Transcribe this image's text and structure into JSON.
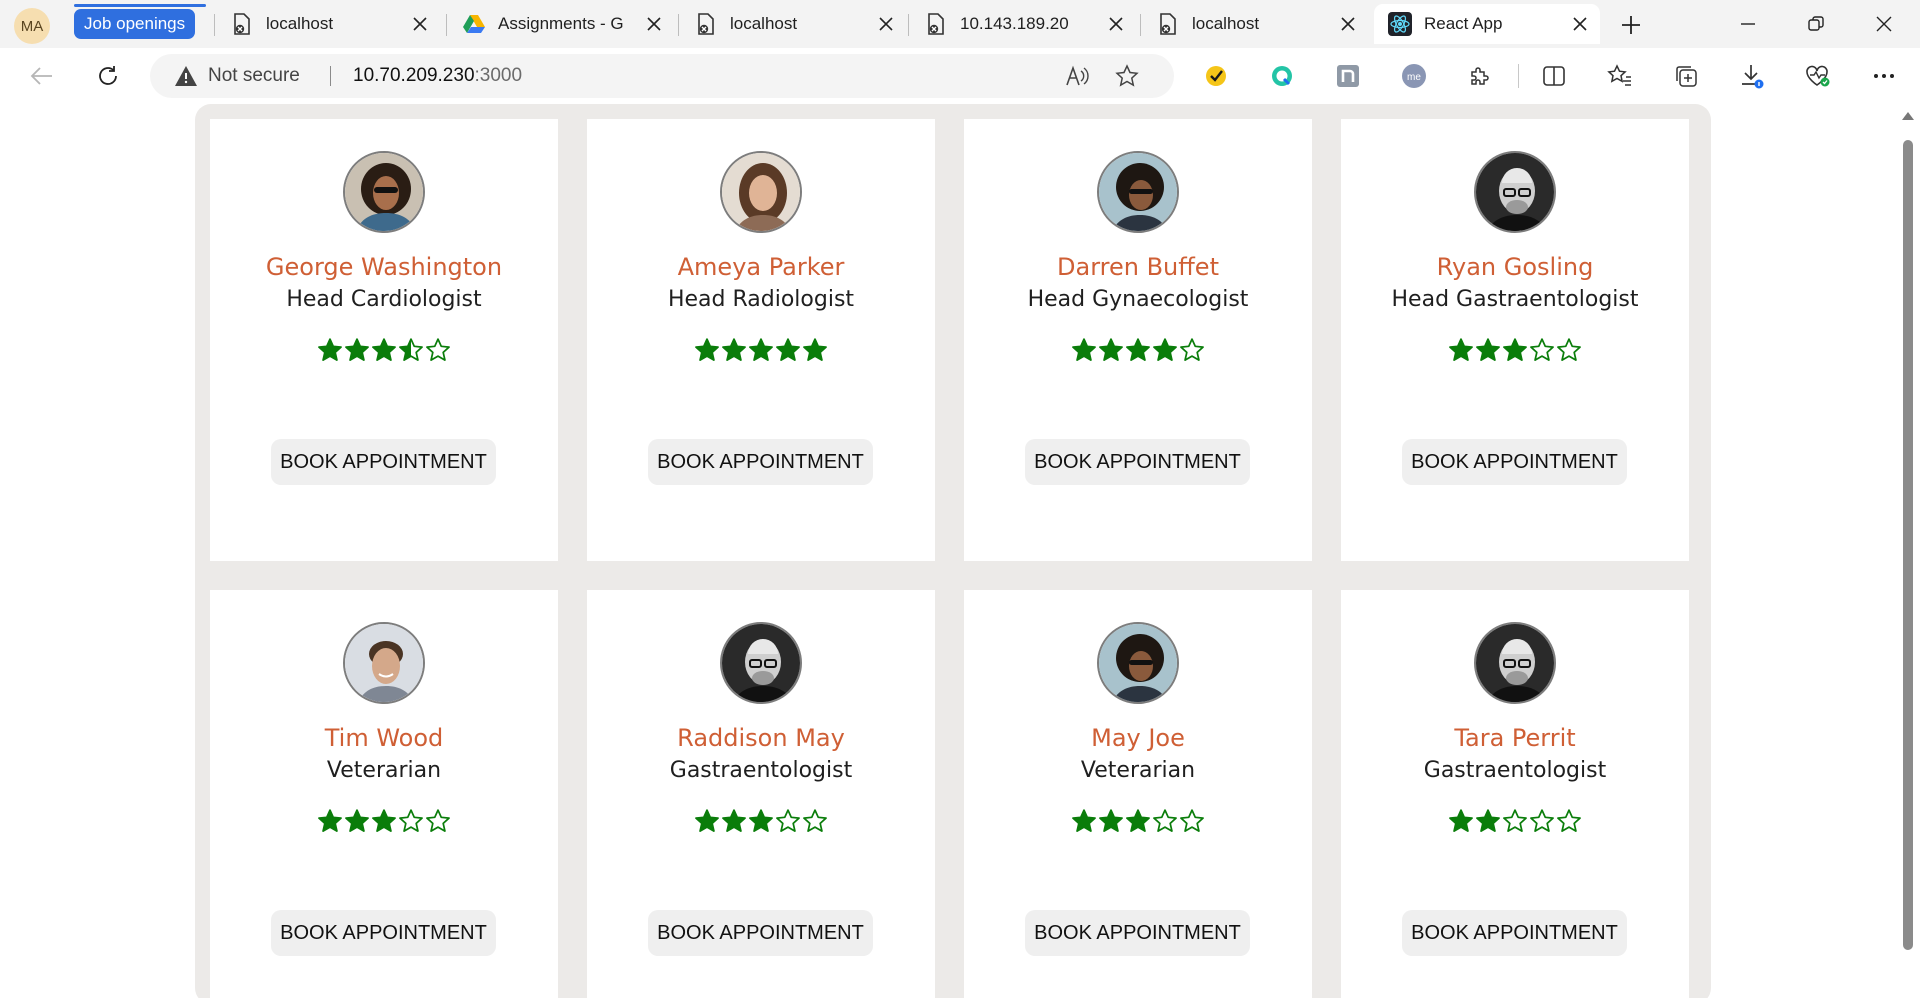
{
  "browser": {
    "profile_initials": "MA",
    "tab_group_label": "Job openings",
    "tabs": [
      {
        "title": "localhost",
        "icon": "blocked-page-icon"
      },
      {
        "title": "Assignments - G",
        "icon": "google-drive-icon"
      },
      {
        "title": "localhost",
        "icon": "blocked-page-icon"
      },
      {
        "title": "10.143.189.20",
        "icon": "blocked-page-icon"
      },
      {
        "title": "localhost",
        "icon": "blocked-page-icon"
      },
      {
        "title": "React App",
        "icon": "react-icon",
        "active": true
      }
    ],
    "address": {
      "security_label": "Not secure",
      "host": "10.70.209.230",
      "port": ":3000"
    }
  },
  "doctors": [
    {
      "name": "George Washington",
      "role": "Head Cardiologist",
      "rating": 3.5,
      "button": "Book Appointment"
    },
    {
      "name": "Ameya Parker",
      "role": "Head Radiologist",
      "rating": 5,
      "button": "Book Appointment"
    },
    {
      "name": "Darren Buffet",
      "role": "Head Gynaecologist",
      "rating": 4,
      "button": "Book Appointment"
    },
    {
      "name": "Ryan Gosling",
      "role": "Head Gastraentologist",
      "rating": 3,
      "button": "Book Appointment"
    },
    {
      "name": "Tim Wood",
      "role": "Veterarian",
      "rating": 3,
      "button": "Book Appointment"
    },
    {
      "name": "Raddison May",
      "role": "Gastraentologist",
      "rating": 3,
      "button": "Book Appointment"
    },
    {
      "name": "May Joe",
      "role": "Veterarian",
      "rating": 3,
      "button": "Book Appointment"
    },
    {
      "name": "Tara Perrit",
      "role": "Gastraentologist",
      "rating": 2,
      "button": "Book Appointment"
    }
  ],
  "colors": {
    "name": "#cf5f35",
    "star": "#0a7d0a",
    "background_panel": "#eceae8",
    "tab_group": "#2f6fdf"
  }
}
